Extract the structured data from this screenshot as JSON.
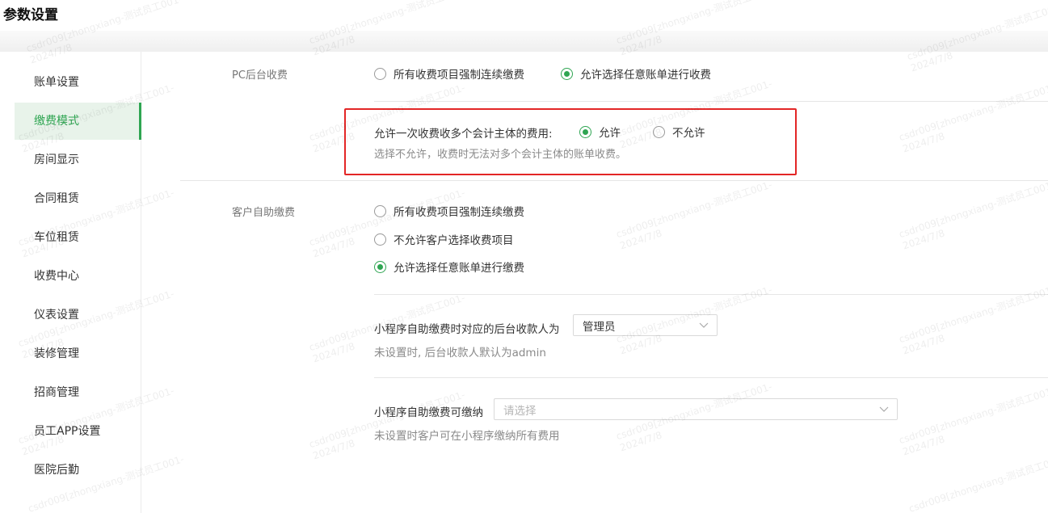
{
  "page": {
    "title": "参数设置"
  },
  "sidebar": {
    "items": [
      {
        "label": "账单设置"
      },
      {
        "label": "缴费模式"
      },
      {
        "label": "房间显示"
      },
      {
        "label": "合同租赁"
      },
      {
        "label": "车位租赁"
      },
      {
        "label": "收费中心"
      },
      {
        "label": "仪表设置"
      },
      {
        "label": "装修管理"
      },
      {
        "label": "招商管理"
      },
      {
        "label": "员工APP设置"
      },
      {
        "label": "医院后勤"
      }
    ],
    "active_index": 1
  },
  "pc_fee": {
    "label": "PC后台收费",
    "options": [
      {
        "label": "所有收费项目强制连续缴费",
        "checked": false
      },
      {
        "label": "允许选择任意账单进行收费",
        "checked": true
      }
    ],
    "multi_entity": {
      "question": "允许一次收费收多个会计主体的费用:",
      "allow_label": "允许",
      "deny_label": "不允许",
      "selected": "允许",
      "hint": "选择不允许，收费时无法对多个会计主体的账单收费。"
    }
  },
  "self_pay": {
    "label": "客户自助缴费",
    "options": [
      {
        "label": "所有收费项目强制连续缴费",
        "checked": false
      },
      {
        "label": "不允许客户选择收费项目",
        "checked": false
      },
      {
        "label": "允许选择任意账单进行缴费",
        "checked": true
      }
    ],
    "payee": {
      "label": "小程序自助缴费时对应的后台收款人为",
      "value": "管理员",
      "hint": "未设置时, 后台收款人默认为admin"
    },
    "payable": {
      "label": "小程序自助缴费可缴纳",
      "placeholder": "请选择",
      "hint": "未设置时客户可在小程序缴纳所有费用"
    }
  },
  "watermark": {
    "line1": "csdr009[zhongxiang-测试员工001-",
    "line2": "2024/7/8"
  }
}
